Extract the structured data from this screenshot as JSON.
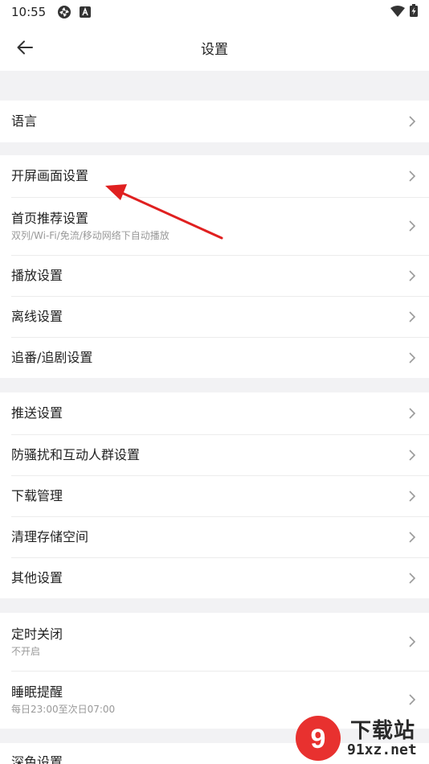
{
  "status_bar": {
    "time": "10:55",
    "icons": [
      "aperture-icon",
      "a-badge-icon",
      "wifi-icon",
      "battery-charging-icon"
    ]
  },
  "header": {
    "title": "设置",
    "back_icon": "arrow-left-icon"
  },
  "sections": [
    {
      "items": [
        {
          "label": "语言"
        }
      ]
    },
    {
      "items": [
        {
          "label": "开屏画面设置"
        },
        {
          "label": "首页推荐设置",
          "sub": "双列/Wi-Fi/免流/移动网络下自动播放"
        },
        {
          "label": "播放设置"
        },
        {
          "label": "离线设置"
        },
        {
          "label": "追番/追剧设置"
        }
      ]
    },
    {
      "items": [
        {
          "label": "推送设置"
        },
        {
          "label": "防骚扰和互动人群设置"
        },
        {
          "label": "下载管理"
        },
        {
          "label": "清理存储空间"
        },
        {
          "label": "其他设置"
        }
      ]
    },
    {
      "items": [
        {
          "label": "定时关闭",
          "sub": "不开启"
        },
        {
          "label": "睡眠提醒",
          "sub": "每日23:00至次日07:00"
        }
      ]
    },
    {
      "items": [
        {
          "label": "深色设置"
        }
      ]
    }
  ],
  "annotation": {
    "color": "#e02020"
  },
  "watermark": {
    "top_text": "下载站",
    "bottom_text": "91xz.net",
    "logo_text": "9"
  },
  "colors": {
    "background": "#f2f2f4",
    "surface": "#ffffff",
    "text": "#222222",
    "subtext": "#999999",
    "chevron": "#9a9a9a"
  }
}
